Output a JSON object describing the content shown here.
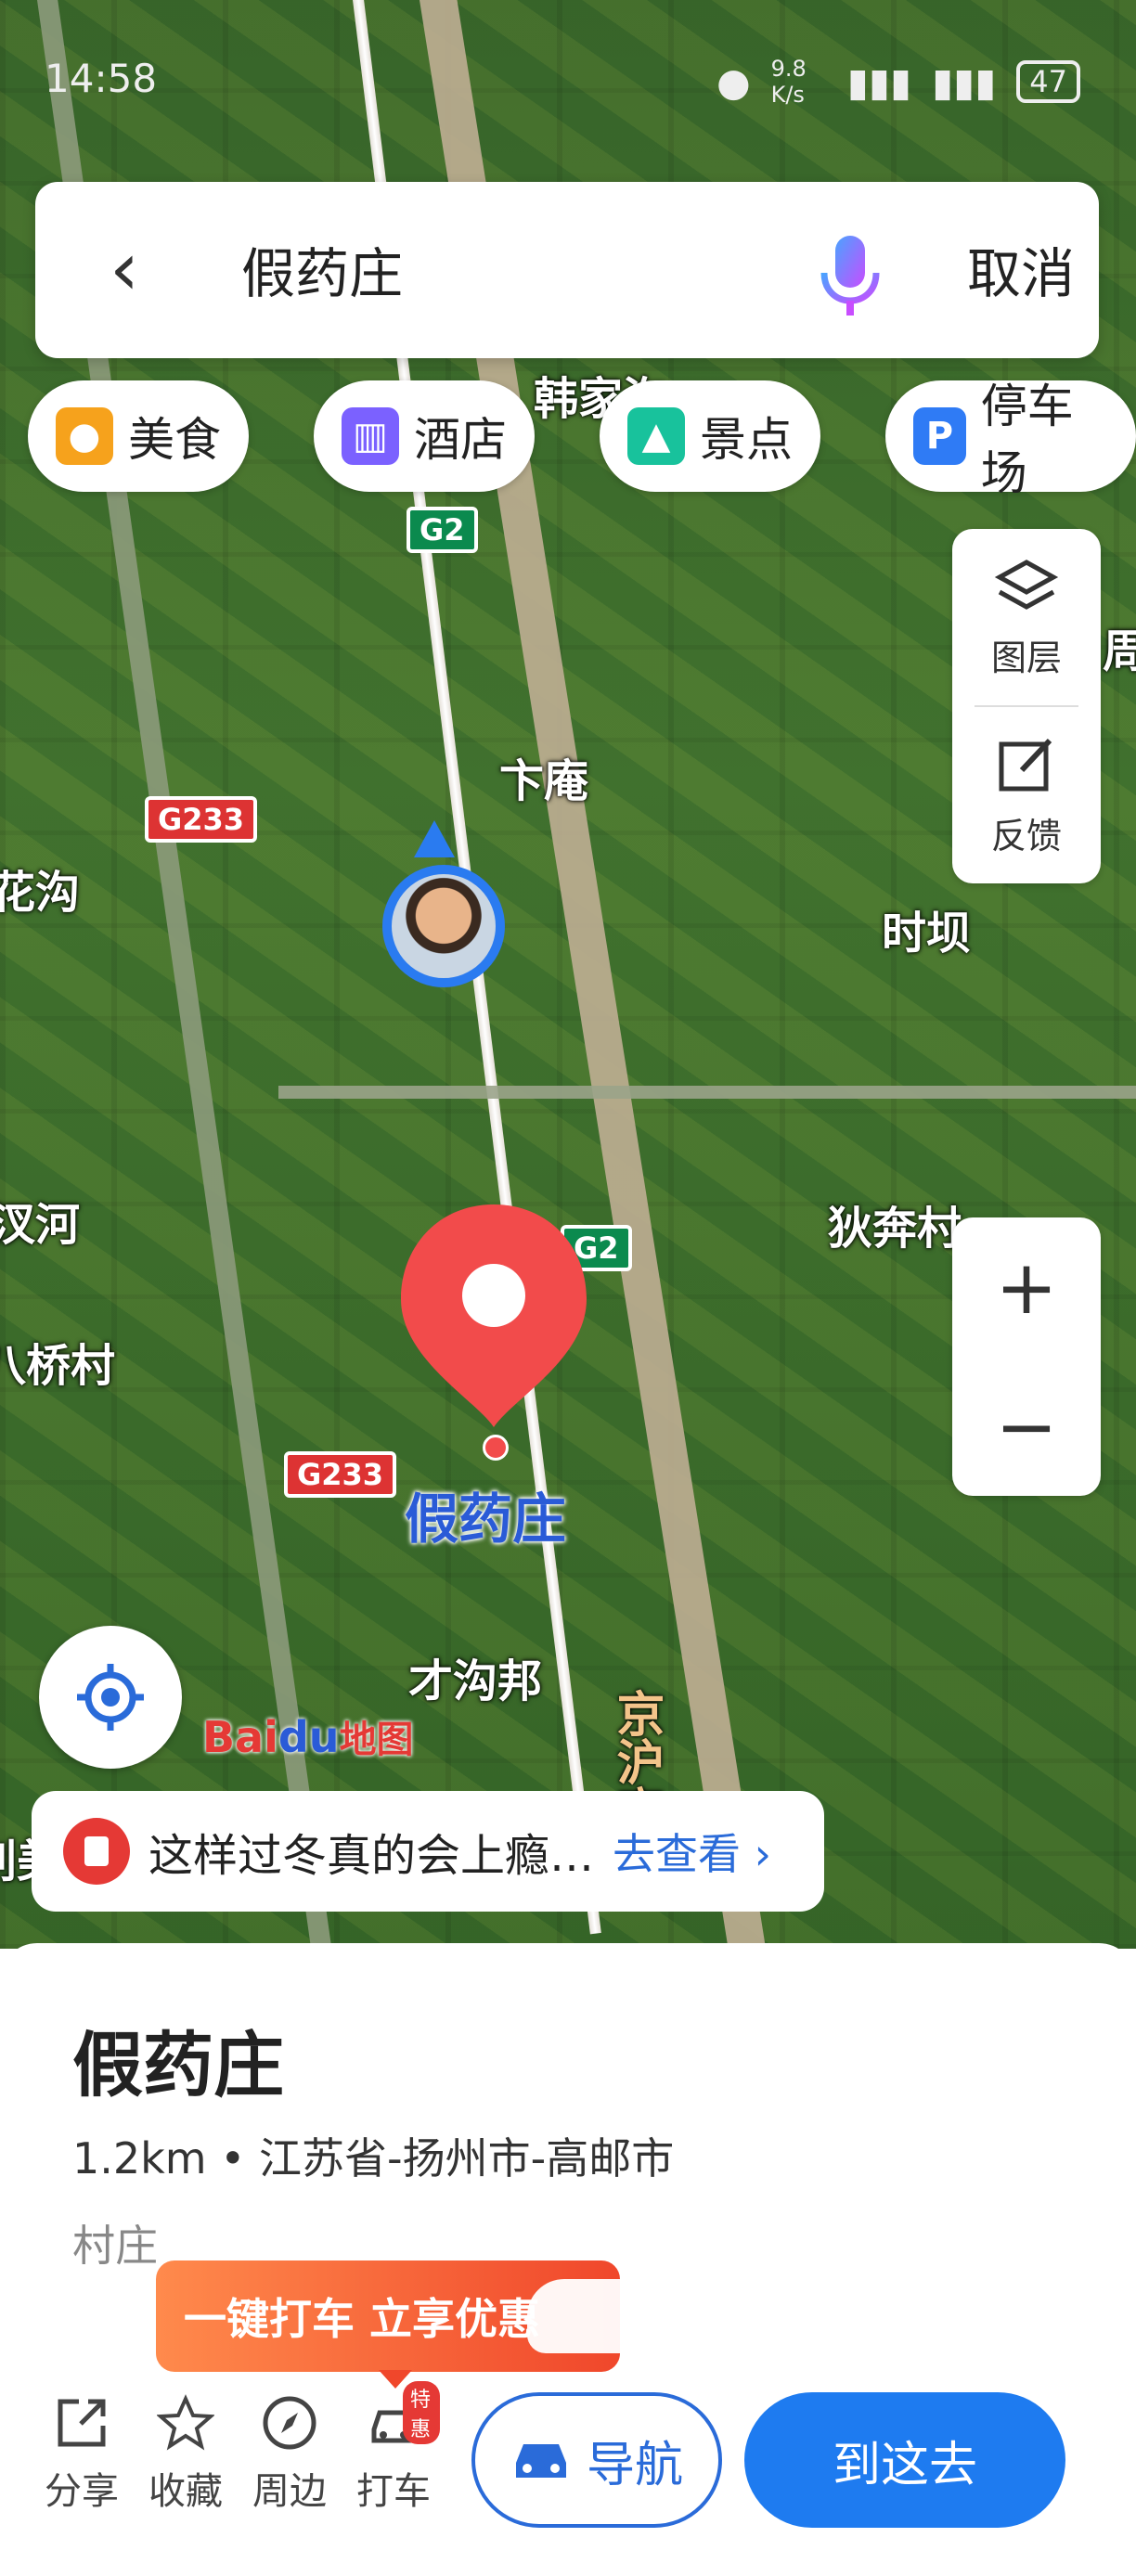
{
  "status_bar": {
    "time": "14:58",
    "network_speed": "9.8 K/s",
    "battery": "47"
  },
  "search": {
    "query": "假药庄",
    "cancel_label": "取消"
  },
  "categories": [
    {
      "label": "美食",
      "icon": "food-icon",
      "color": "#f6a21c"
    },
    {
      "label": "酒店",
      "icon": "hotel-icon",
      "color": "#7b61ff"
    },
    {
      "label": "景点",
      "icon": "scenic-icon",
      "color": "#18c29c"
    },
    {
      "label": "停车场",
      "icon": "parking-icon",
      "color": "#2f7bf5"
    }
  ],
  "map_tools": {
    "layers_label": "图层",
    "feedback_label": "反馈",
    "zoom_in": "+",
    "zoom_out": "−"
  },
  "map_labels": {
    "village_bottom_top": "韩家沟",
    "xiaan": "卞庵",
    "huagou": "花沟",
    "shiba": "时坝",
    "chahe": "汊河",
    "qiaocun": "八桥村",
    "dibencun": "狄奔村",
    "jiayaozhuang": "假药庄",
    "caigoubang": "才沟邦",
    "expressway": "京沪高速",
    "right_edge": "周凡",
    "left_edge": "刘美"
  },
  "road_shields": {
    "g2_top": "G2",
    "g2_mid": "G2",
    "g233_top": "G233",
    "g233_mid": "G233"
  },
  "logo": {
    "brand_a": "Bai",
    "brand_b": "du",
    "brand_c": "地图"
  },
  "news": {
    "text": "这样过冬真的会上瘾…",
    "link": "去查看"
  },
  "place": {
    "name": "假药庄",
    "distance": "1.2km",
    "separator": "•",
    "address": "江苏省-扬州市-高邮市",
    "type": "村庄"
  },
  "promo": {
    "text": "一键打车 立享优惠"
  },
  "actions": [
    {
      "label": "分享",
      "icon": "share-icon"
    },
    {
      "label": "收藏",
      "icon": "star-icon"
    },
    {
      "label": "周边",
      "icon": "compass-icon"
    },
    {
      "label": "打车",
      "icon": "taxi-icon",
      "badge": "特惠"
    }
  ],
  "buttons": {
    "navigate": "导航",
    "go_here": "到这去"
  }
}
